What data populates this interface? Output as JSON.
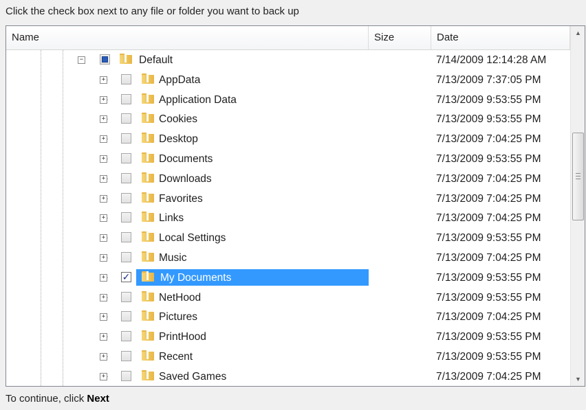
{
  "instruction": "Click the check box next to any file or folder you want to back up",
  "columns": {
    "name": "Name",
    "size": "Size",
    "date": "Date"
  },
  "root": {
    "name": "Default",
    "date": "7/14/2009 12:14:28 AM",
    "check_state": "partial"
  },
  "items": [
    {
      "name": "AppData",
      "date": "7/13/2009 7:37:05 PM",
      "checked": false
    },
    {
      "name": "Application Data",
      "date": "7/13/2009 9:53:55 PM",
      "checked": false
    },
    {
      "name": "Cookies",
      "date": "7/13/2009 9:53:55 PM",
      "checked": false
    },
    {
      "name": "Desktop",
      "date": "7/13/2009 7:04:25 PM",
      "checked": false
    },
    {
      "name": "Documents",
      "date": "7/13/2009 9:53:55 PM",
      "checked": false
    },
    {
      "name": "Downloads",
      "date": "7/13/2009 7:04:25 PM",
      "checked": false
    },
    {
      "name": "Favorites",
      "date": "7/13/2009 7:04:25 PM",
      "checked": false
    },
    {
      "name": "Links",
      "date": "7/13/2009 7:04:25 PM",
      "checked": false
    },
    {
      "name": "Local Settings",
      "date": "7/13/2009 9:53:55 PM",
      "checked": false
    },
    {
      "name": "Music",
      "date": "7/13/2009 7:04:25 PM",
      "checked": false
    },
    {
      "name": "My Documents",
      "date": "7/13/2009 9:53:55 PM",
      "checked": true,
      "selected": true
    },
    {
      "name": "NetHood",
      "date": "7/13/2009 9:53:55 PM",
      "checked": false
    },
    {
      "name": "Pictures",
      "date": "7/13/2009 7:04:25 PM",
      "checked": false
    },
    {
      "name": "PrintHood",
      "date": "7/13/2009 9:53:55 PM",
      "checked": false
    },
    {
      "name": "Recent",
      "date": "7/13/2009 9:53:55 PM",
      "checked": false
    },
    {
      "name": "Saved Games",
      "date": "7/13/2009 7:04:25 PM",
      "checked": false
    }
  ],
  "footer": {
    "prefix": "To continue, click ",
    "action": "Next"
  },
  "colors": {
    "selection": "#3399ff",
    "checkmark": "#1a2c80"
  }
}
